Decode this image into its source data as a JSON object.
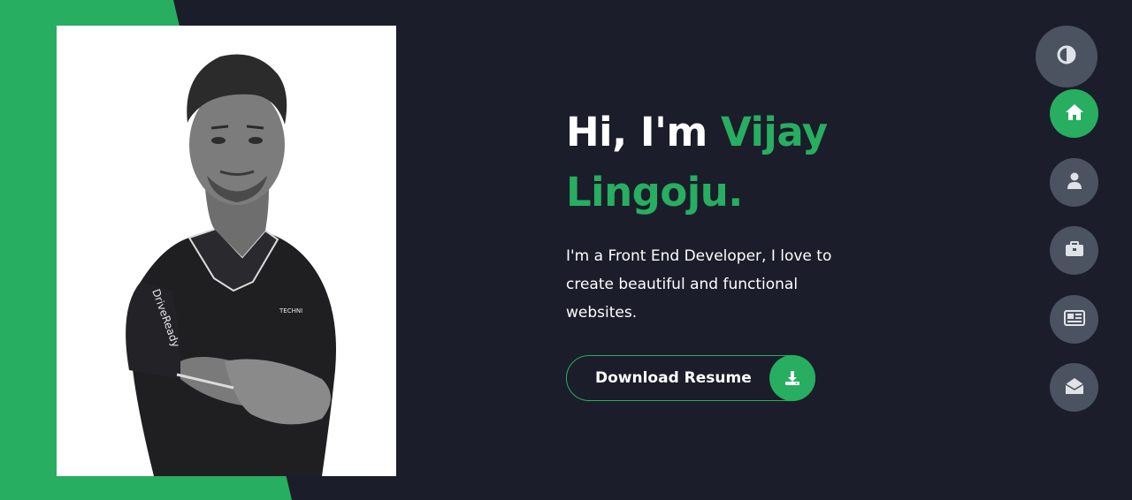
{
  "hero": {
    "greeting": "Hi, I'm",
    "name_first": "Vijay",
    "name_last": "Lingoju.",
    "description": "I'm a Front End Developer, I love to create beautiful and functional websites.",
    "resume_button": "Download Resume"
  },
  "photo": {
    "shirt_text_sleeve": "DriveReady",
    "shirt_text_chest": "TECHNI"
  },
  "nav": {
    "theme_toggle_icon": "half-circle-icon",
    "items": [
      {
        "name": "home",
        "icon": "home-icon",
        "active": true
      },
      {
        "name": "about",
        "icon": "user-icon",
        "active": false
      },
      {
        "name": "portfolio",
        "icon": "briefcase-icon",
        "active": false
      },
      {
        "name": "blog",
        "icon": "newspaper-icon",
        "active": false
      },
      {
        "name": "contact",
        "icon": "envelope-open-icon",
        "active": false
      }
    ]
  },
  "colors": {
    "background": "#1b1d2a",
    "accent": "#27ae60",
    "nav_button": "#4b5260",
    "icon": "#dfe3e8"
  }
}
